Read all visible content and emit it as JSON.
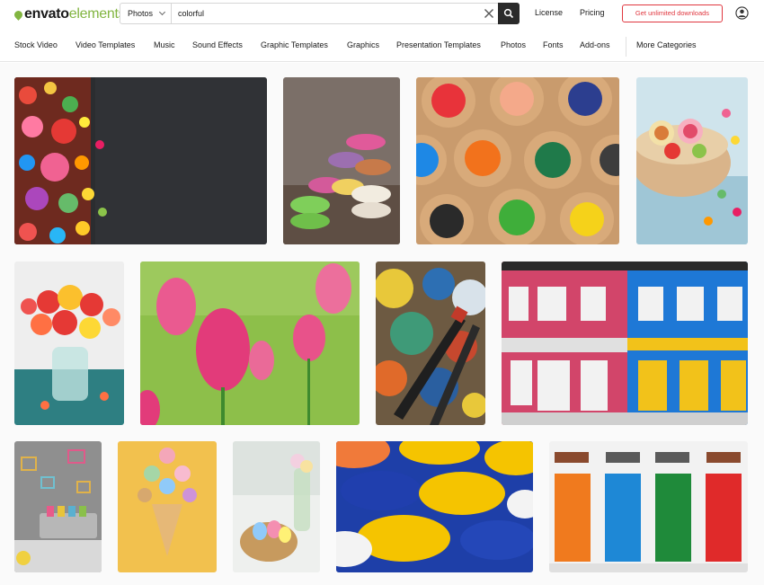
{
  "header": {
    "logo_primary": "envato",
    "logo_secondary": "elements",
    "search": {
      "category": "Photos",
      "query": "colorful"
    },
    "links": {
      "license": "License",
      "pricing": "Pricing"
    },
    "cta_label": "Get unlimited downloads",
    "icons": {
      "search": "search-icon",
      "clear": "close-icon",
      "account": "account-icon",
      "dropdown": "chevron-down-icon"
    }
  },
  "category_nav": {
    "items": [
      "Stock Video",
      "Video Templates",
      "Music",
      "Sound Effects",
      "Graphic Templates",
      "Graphics",
      "Presentation Templates",
      "Photos",
      "Fonts",
      "Add-ons"
    ],
    "more": "More Categories"
  },
  "colors": {
    "brand_green": "#82b541",
    "cta_red": "#e0373f",
    "search_button": "#2a2a2a"
  },
  "watermark": "envatoelements",
  "gallery": {
    "rows": [
      [
        "candy on dark slate",
        "stacked macarons",
        "colored pencil tips",
        "candy bowl"
      ],
      [
        "rose bouquet in vase",
        "pink tulips",
        "paint palette with brushes",
        "colorful building facade"
      ],
      [
        "pastel room interior",
        "macaron ice cream cone",
        "easter egg basket",
        "yellow and blue umbrellas",
        "colorful doors"
      ]
    ]
  }
}
